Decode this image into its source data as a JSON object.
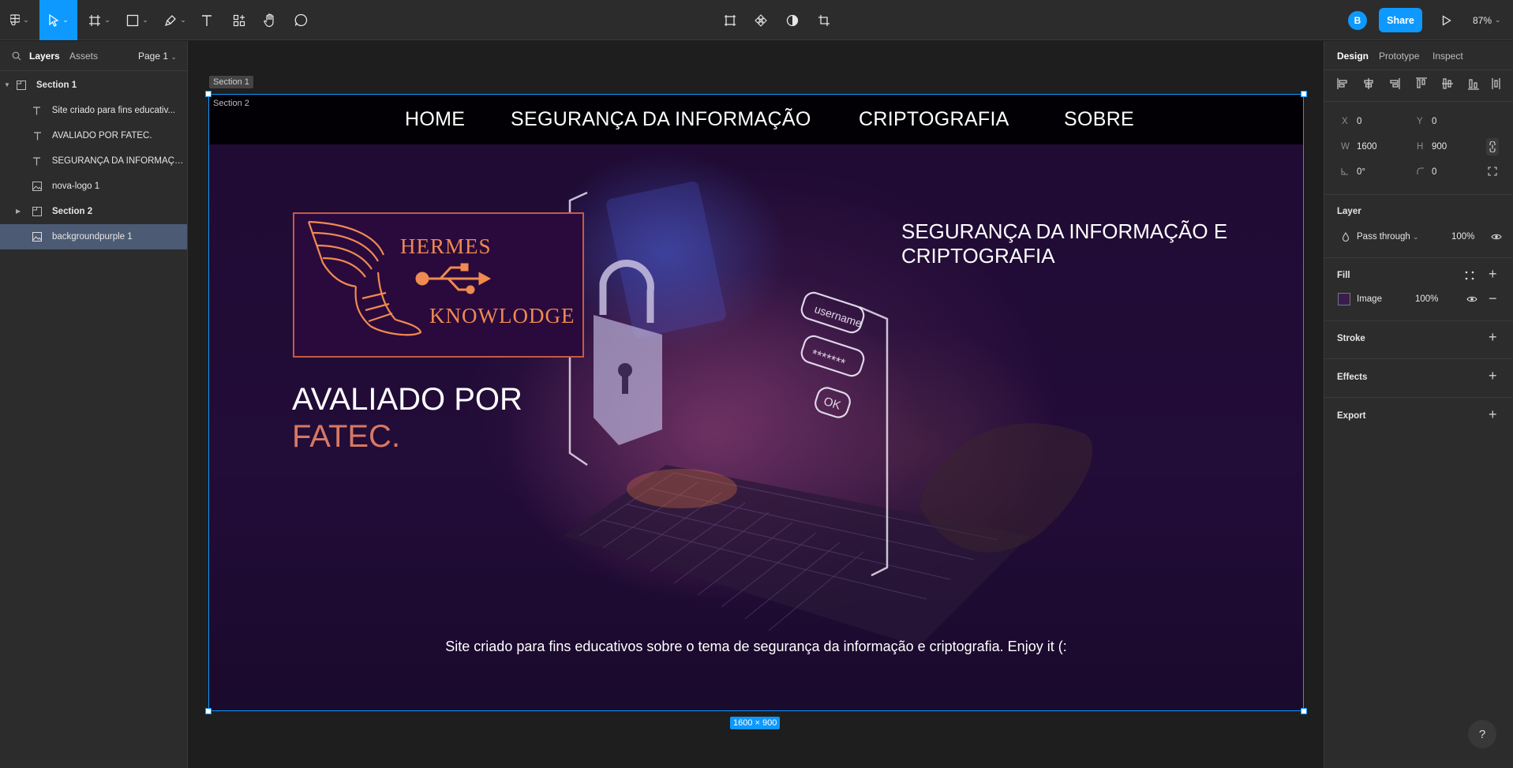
{
  "toolbar": {
    "zoom": "87%",
    "user_initial": "B",
    "share_label": "Share"
  },
  "left_panel": {
    "tabs": [
      "Layers",
      "Assets"
    ],
    "page_selector": "Page 1",
    "layers": [
      {
        "name": "Section 1",
        "type": "section"
      },
      {
        "name": "Site criado para fins educativ...",
        "type": "text"
      },
      {
        "name": "AVALIADO POR FATEC.",
        "type": "text"
      },
      {
        "name": "SEGURANÇA DA INFORMAÇÃ...",
        "type": "text"
      },
      {
        "name": "nova-logo 1",
        "type": "image"
      },
      {
        "name": "Section 2",
        "type": "section"
      },
      {
        "name": "backgroundpurple 1",
        "type": "image"
      }
    ]
  },
  "canvas": {
    "section1_label": "Section 1",
    "section2_label": "Section 2",
    "size_badge": "1600 × 900",
    "nav": [
      "HOME",
      "SEGURANÇA DA INFORMAÇÃO",
      "CRIPTOGRAFIA",
      "SOBRE"
    ],
    "logo": {
      "line1": "HERMES",
      "line2": "KNOWLODGE"
    },
    "evaluated": {
      "line1": "AVALIADO POR",
      "line2": "FATEC."
    },
    "hero_heading": "SEGURANÇA DA INFORMAÇÃO E CRIPTOGRAFIA",
    "footer_text": "Site criado para fins educativos sobre o tema de segurança da informação e criptografia. Enjoy it (:",
    "illustration": {
      "username": "username",
      "password": "*******",
      "ok": "OK"
    }
  },
  "right_panel": {
    "tabs": [
      "Design",
      "Prototype",
      "Inspect"
    ],
    "x": "0",
    "y": "0",
    "w": "1600",
    "h": "900",
    "rotation": "0°",
    "radius": "0",
    "layer_title": "Layer",
    "blend_mode": "Pass through",
    "layer_opacity": "100%",
    "fill_title": "Fill",
    "fill_type": "Image",
    "fill_opacity": "100%",
    "stroke_title": "Stroke",
    "effects_title": "Effects",
    "export_title": "Export",
    "labels": {
      "x": "X",
      "y": "Y",
      "w": "W",
      "h": "H"
    }
  },
  "help": "?",
  "colors": {
    "accent": "#0d99ff",
    "logo_orange": "#ef8a50",
    "fatec_salmon": "#d77864",
    "panel_bg": "#2c2c2c",
    "canvas_bg": "#1e1e1e"
  }
}
